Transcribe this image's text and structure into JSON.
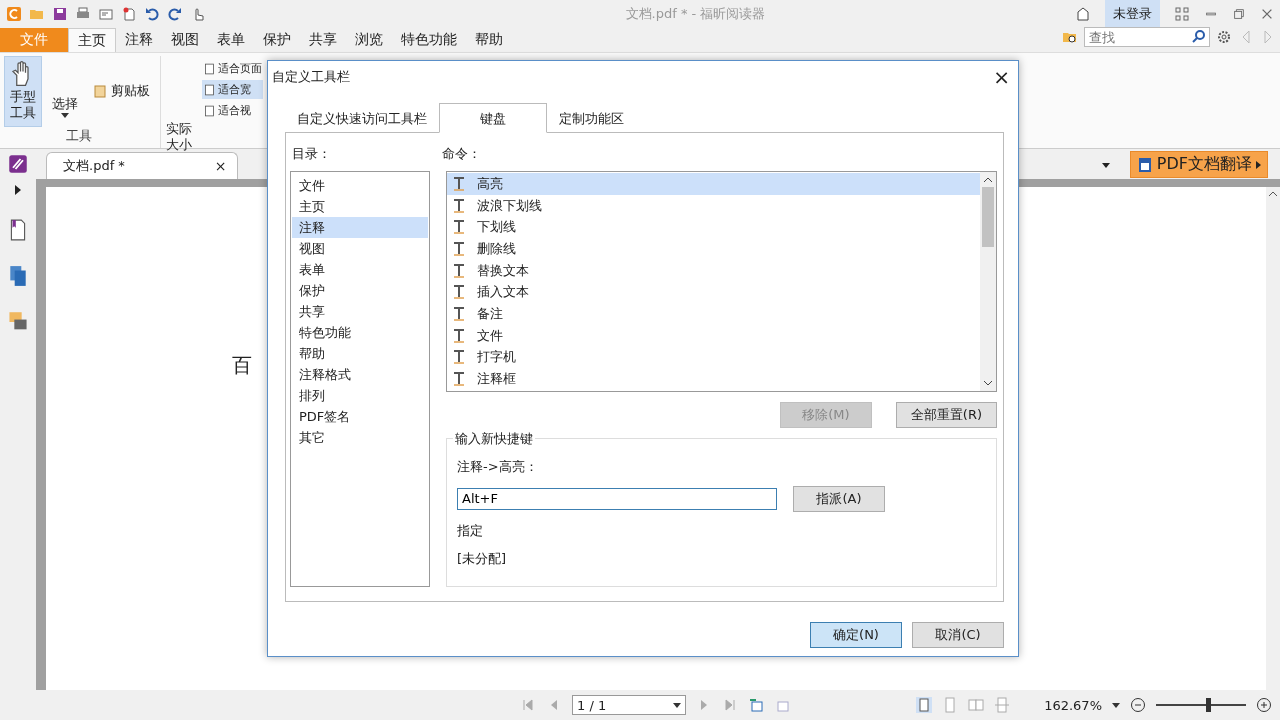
{
  "window": {
    "title": "文档.pdf * - 福昕阅读器",
    "account": "未登录"
  },
  "menu_tabs": [
    {
      "label": "文件",
      "kind": "file",
      "selected": false
    },
    {
      "label": "主页",
      "kind": "tab",
      "selected": true
    },
    {
      "label": "注释",
      "kind": "tab",
      "selected": false
    },
    {
      "label": "视图",
      "kind": "tab",
      "selected": false
    },
    {
      "label": "表单",
      "kind": "tab",
      "selected": false
    },
    {
      "label": "保护",
      "kind": "tab",
      "selected": false
    },
    {
      "label": "共享",
      "kind": "tab",
      "selected": false
    },
    {
      "label": "浏览",
      "kind": "tab",
      "selected": false
    },
    {
      "label": "特色功能",
      "kind": "tab",
      "selected": false
    },
    {
      "label": "帮助",
      "kind": "tab",
      "selected": false
    }
  ],
  "search": {
    "placeholder": "查找"
  },
  "ribbon": {
    "hand_tool": {
      "label": "手型工具",
      "selected": true
    },
    "select_tool": "选择",
    "clipboard": "剪贴板",
    "group_label": "工具",
    "actual_size": "实际大小",
    "fit_items": [
      {
        "label": "适合页面",
        "selected": false
      },
      {
        "label": "适合宽",
        "selected": true
      },
      {
        "label": "适合视",
        "selected": false
      }
    ]
  },
  "doc_tab": {
    "label": "文档.pdf *",
    "close": "×"
  },
  "translate_button": "PDF文档翻译",
  "page_text": "百",
  "dialog": {
    "title": "自定义工具栏",
    "close": "×",
    "tabs": [
      {
        "label": "自定义快速访问工具栏",
        "selected": false
      },
      {
        "label": "键盘",
        "selected": true
      },
      {
        "label": "定制功能区",
        "selected": false
      }
    ],
    "category_label": "目录：",
    "command_label": "命令：",
    "categories": [
      {
        "label": "文件",
        "selected": false
      },
      {
        "label": "主页",
        "selected": false
      },
      {
        "label": "注释",
        "selected": true
      },
      {
        "label": "视图",
        "selected": false
      },
      {
        "label": "表单",
        "selected": false
      },
      {
        "label": "保护",
        "selected": false
      },
      {
        "label": "共享",
        "selected": false
      },
      {
        "label": "特色功能",
        "selected": false
      },
      {
        "label": "帮助",
        "selected": false
      },
      {
        "label": "注释格式",
        "selected": false
      },
      {
        "label": "排列",
        "selected": false
      },
      {
        "label": "PDF签名",
        "selected": false
      },
      {
        "label": "其它",
        "selected": false
      }
    ],
    "commands": [
      {
        "label": "高亮",
        "selected": true
      },
      {
        "label": "波浪下划线",
        "selected": false
      },
      {
        "label": "下划线",
        "selected": false
      },
      {
        "label": "删除线",
        "selected": false
      },
      {
        "label": "替换文本",
        "selected": false
      },
      {
        "label": "插入文本",
        "selected": false
      },
      {
        "label": "备注",
        "selected": false
      },
      {
        "label": "文件",
        "selected": false
      },
      {
        "label": "打字机",
        "selected": false
      },
      {
        "label": "注释框",
        "selected": false
      }
    ],
    "remove_button": {
      "label": "移除(M)",
      "disabled": true
    },
    "reset_button": {
      "label": "全部重置(R)",
      "disabled": false
    },
    "shortcut_group": "输入新快捷键",
    "command_path": "注释->高亮：",
    "shortcut_value": "Alt+F",
    "assign_button": "指派(A)",
    "assigned_label": "指定",
    "assigned_value": "[未分配]",
    "ok_button": "确定(N)",
    "cancel_button": "取消(C)"
  },
  "status": {
    "page": "1 / 1",
    "zoom": "162.67%",
    "zoom_slider": {
      "level": 0.58
    }
  }
}
